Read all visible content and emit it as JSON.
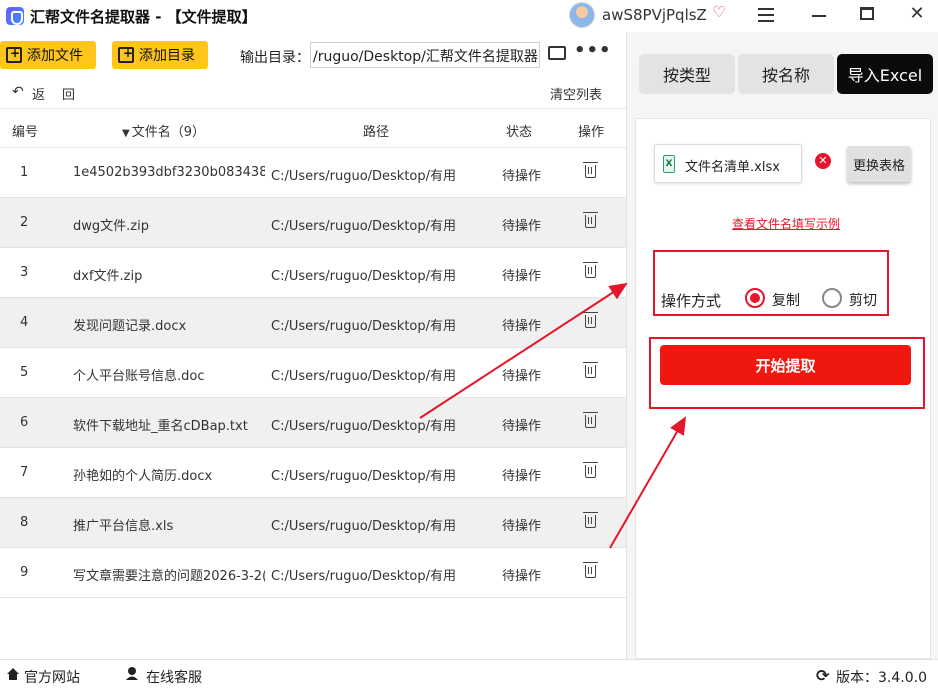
{
  "window": {
    "title": "汇帮文件名提取器 - 【文件提取】",
    "user": "awS8PVjPqlsZ",
    "close_glyph": "✕"
  },
  "toolbar": {
    "add_file": "添加文件",
    "add_dir": "添加目录",
    "output_label": "输出目录：",
    "output_path": "/ruguo/Desktop/汇帮文件名提取器",
    "more": "•••"
  },
  "actions": {
    "undo_glyph": "↶",
    "back": "返",
    "redo": "回",
    "clear": "清空列表"
  },
  "table": {
    "headers": {
      "no": "编号",
      "name": "文件名（9）",
      "path": "路径",
      "status": "状态",
      "action": "操作"
    },
    "rows": [
      {
        "no": "1",
        "name": "1e4502b393dbf3230b083438b...",
        "path": "C:/Users/ruguo/Desktop/有用...",
        "status": "待操作"
      },
      {
        "no": "2",
        "name": "dwg文件.zip",
        "path": "C:/Users/ruguo/Desktop/有用...",
        "status": "待操作"
      },
      {
        "no": "3",
        "name": "dxf文件.zip",
        "path": "C:/Users/ruguo/Desktop/有用...",
        "status": "待操作"
      },
      {
        "no": "4",
        "name": "发现问题记录.docx",
        "path": "C:/Users/ruguo/Desktop/有用...",
        "status": "待操作"
      },
      {
        "no": "5",
        "name": "个人平台账号信息.doc",
        "path": "C:/Users/ruguo/Desktop/有用...",
        "status": "待操作"
      },
      {
        "no": "6",
        "name": "软件下载地址_重名cDBap.txt",
        "path": "C:/Users/ruguo/Desktop/有用...",
        "status": "待操作"
      },
      {
        "no": "7",
        "name": "孙艳如的个人简历.docx",
        "path": "C:/Users/ruguo/Desktop/有用...",
        "status": "待操作"
      },
      {
        "no": "8",
        "name": "推广平台信息.xls",
        "path": "C:/Users/ruguo/Desktop/有用...",
        "status": "待操作"
      },
      {
        "no": "9",
        "name": "写文章需要注意的问题2026-3-2(...",
        "path": "C:/Users/ruguo/Desktop/有用...",
        "status": "待操作"
      }
    ]
  },
  "tabs": {
    "by_type": "按类型",
    "by_name": "按名称",
    "import_excel": "导入Excel"
  },
  "excel": {
    "icon_letter": "X",
    "file_name": "文件名清单.xlsx",
    "remove_glyph": "✕",
    "replace": "更换表格",
    "example_link": "查看文件名填写示例"
  },
  "operation": {
    "label": "操作方式",
    "copy": "复制",
    "cut": "剪切",
    "selected": "copy"
  },
  "start_button": "开始提取",
  "footer": {
    "website": "官方网站",
    "service": "在线客服",
    "version": "版本：3.4.0.0"
  },
  "colors": {
    "accent_red": "#e5162a",
    "start_red": "#f0170e",
    "yellow": "#ffc51a"
  }
}
